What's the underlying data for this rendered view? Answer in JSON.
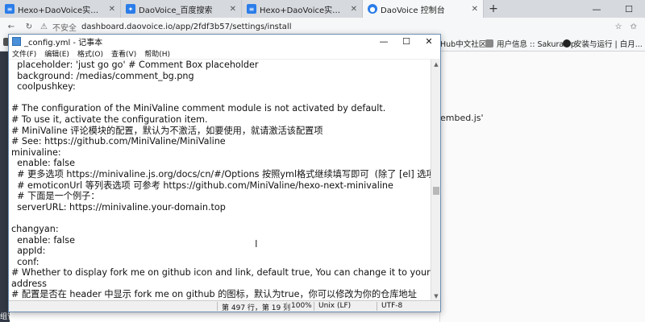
{
  "browser": {
    "tabs": [
      {
        "label": "Hexo+DaoVoice实现网页在线通",
        "icon_color": "#2b7de9"
      },
      {
        "label": "DaoVoice_百度搜索",
        "icon_color": "#2b7de9"
      },
      {
        "label": "Hexo+DaoVoice实现网页在线通",
        "icon_color": "#2b7de9"
      },
      {
        "label": "DaoVoice 控制台",
        "icon_color": "#2b7de9"
      }
    ],
    "insecure_label": "不安全",
    "url": "dashboard.daovoice.io/app/2fdf3b57/settings/install",
    "bookmarks": [
      {
        "label": "Hub中文社区"
      },
      {
        "label": "用户信息 :: SakuraFrp"
      },
      {
        "label": "安装与运行 | 白月..."
      }
    ]
  },
  "page": {
    "embed_text": "embed.js'",
    "bottom_text": "组管理"
  },
  "notepad": {
    "title": "_config.yml - 记事本",
    "menu": [
      "文件(F)",
      "编辑(E)",
      "格式(O)",
      "查看(V)",
      "帮助(H)"
    ],
    "lines": [
      "  placeholder: 'just go go' # Comment Box placeholder",
      "  background: /medias/comment_bg.png",
      "  coolpushkey:",
      "",
      "# The configuration of the MiniValine comment module is not activated by default.",
      "# To use it, activate the configuration item.",
      "# MiniValine 评论模块的配置，默认为不激活，如要使用，就请激活该配置项",
      "# See: https://github.com/MiniValine/MiniValine",
      "minivaline:",
      "  enable: false",
      "  # 更多选项 https://minivaline.js.org/docs/cn/#/Options 按照yml格式继续填写即可  (除了 [el] 选项)",
      "  # emoticonUrl 等列表选项 可参考 https://github.com/MiniValine/hexo-next-minivaline",
      "  # 下面是一个例子：",
      "  serverURL: https://minivaline.your-domain.top",
      "",
      "changyan:",
      "  enable: false",
      "  appId:",
      "  conf:",
      "# Whether to display fork me on github icon and link, default true, You can change it to your repo",
      "address",
      "# 配置是否在 header 中显示 fork me on github 的图标，默认为true，你可以修改为你的仓库地址"
    ],
    "status": {
      "position": "第 497 行，第 19 列",
      "zoom": "100%",
      "line_ending": "Unix (LF)",
      "encoding": "UTF-8"
    }
  },
  "colors": {
    "sidebar_dark": "#333a45",
    "notepad_border": "#6b8fb3"
  }
}
